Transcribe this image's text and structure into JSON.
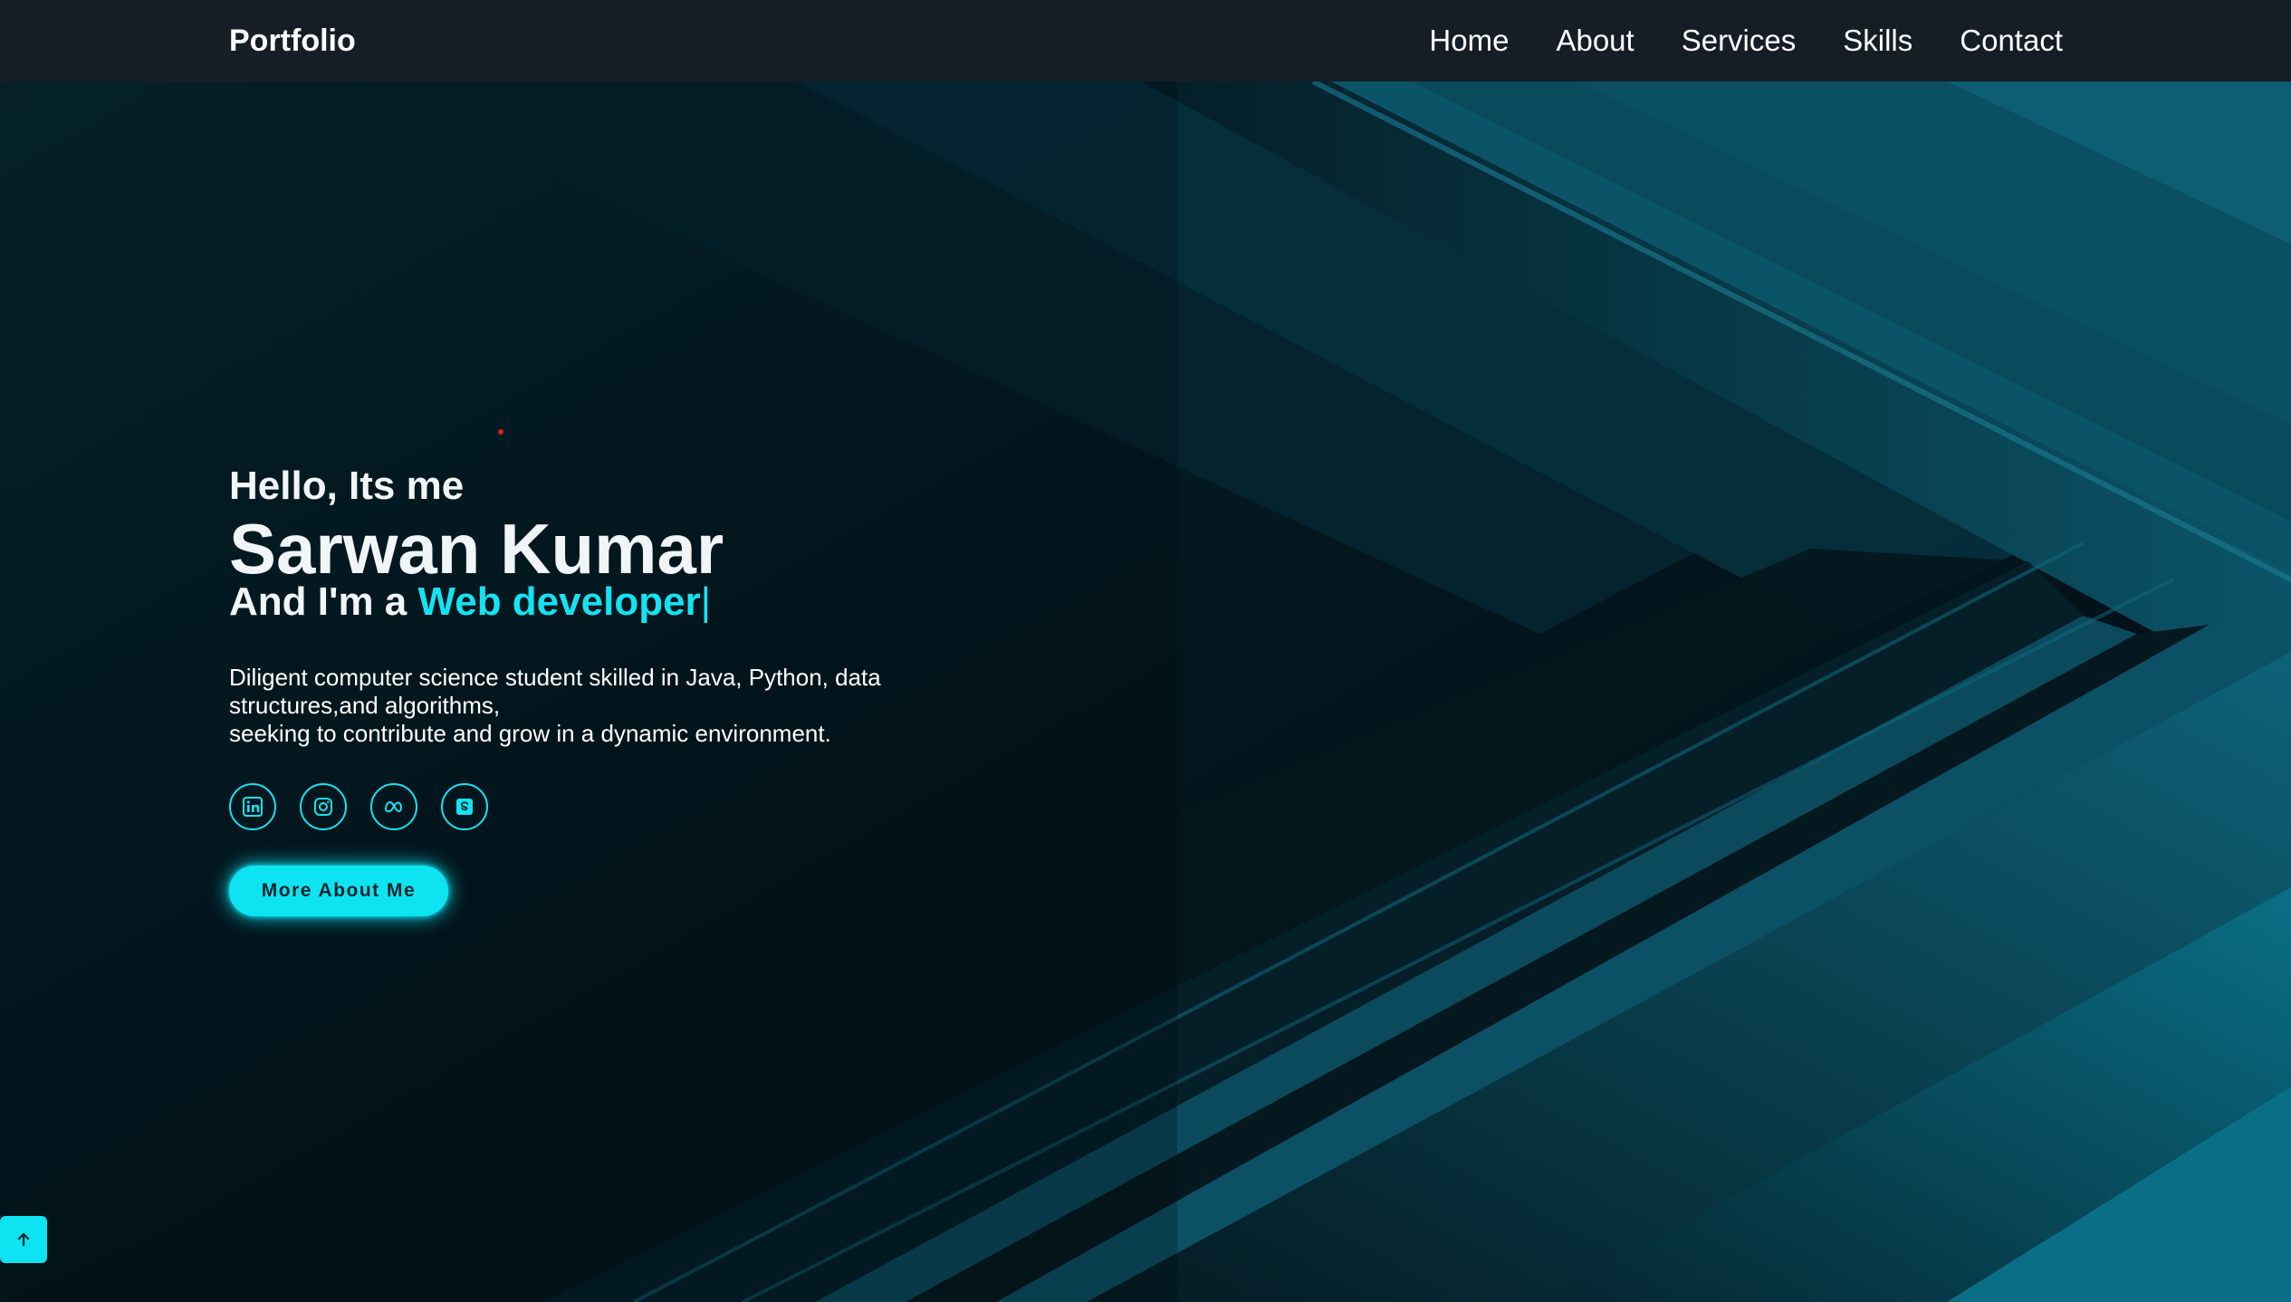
{
  "navbar": {
    "brand": "Portfolio",
    "links": [
      "Home",
      "About",
      "Services",
      "Skills",
      "Contact"
    ]
  },
  "hero": {
    "greeting": "Hello, Its me",
    "name": "Sarwan Kumar",
    "role_prefix": "And I'm a",
    "role": "Web developer",
    "cursor": "|",
    "description_lines": [
      "Diligent computer science student skilled in Java, Python, data",
      "structures,and algorithms,",
      "seeking to contribute and grow in a dynamic environment."
    ],
    "socials": [
      {
        "icon": "linkedin-icon"
      },
      {
        "icon": "instagram-icon"
      },
      {
        "icon": "meta-icon"
      },
      {
        "icon": "skype-icon"
      }
    ],
    "cta_label": "More About Me"
  },
  "scroll_top": {
    "icon": "arrow-up-icon"
  },
  "colors": {
    "accent": "#13e3f2",
    "navbar_bg": "#151e27",
    "background_dark": "#03131a",
    "background_teal": "#0e5f73"
  }
}
